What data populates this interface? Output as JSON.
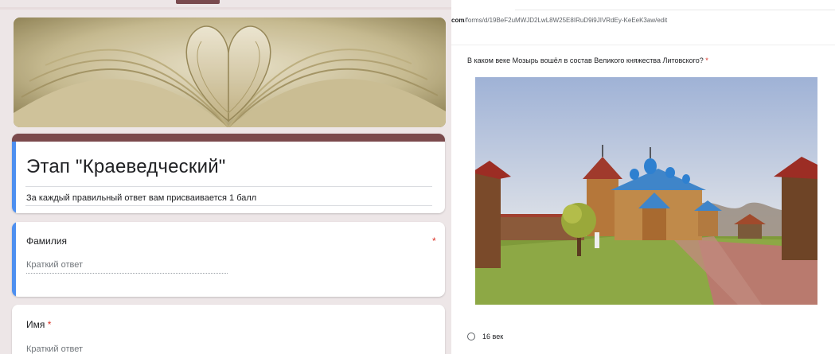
{
  "form": {
    "title": "Этап \"Краеведческий\"",
    "description": "За каждый правильный ответ вам присваивается 1 балл",
    "accent_color": "#7b4a4c",
    "active_color": "#4d8ff0",
    "required_color": "#d93025"
  },
  "questions": [
    {
      "label": "Фамилия",
      "required_mark": "*",
      "placeholder": "Краткий ответ"
    },
    {
      "label": "Имя",
      "required_mark": "*",
      "placeholder": "Краткий ответ"
    }
  ],
  "browser": {
    "url_domain": "com",
    "url_path": "/forms/d/19BeF2uMWJD2LwL8W25E8IRuD9i9JIVRdEy-KeEeK3aw/edit"
  },
  "quiz": {
    "question": "В каком веке Мозырь вошёл в состав Великого княжества Литовского?",
    "required_mark": "*",
    "options": [
      "16 век"
    ]
  }
}
